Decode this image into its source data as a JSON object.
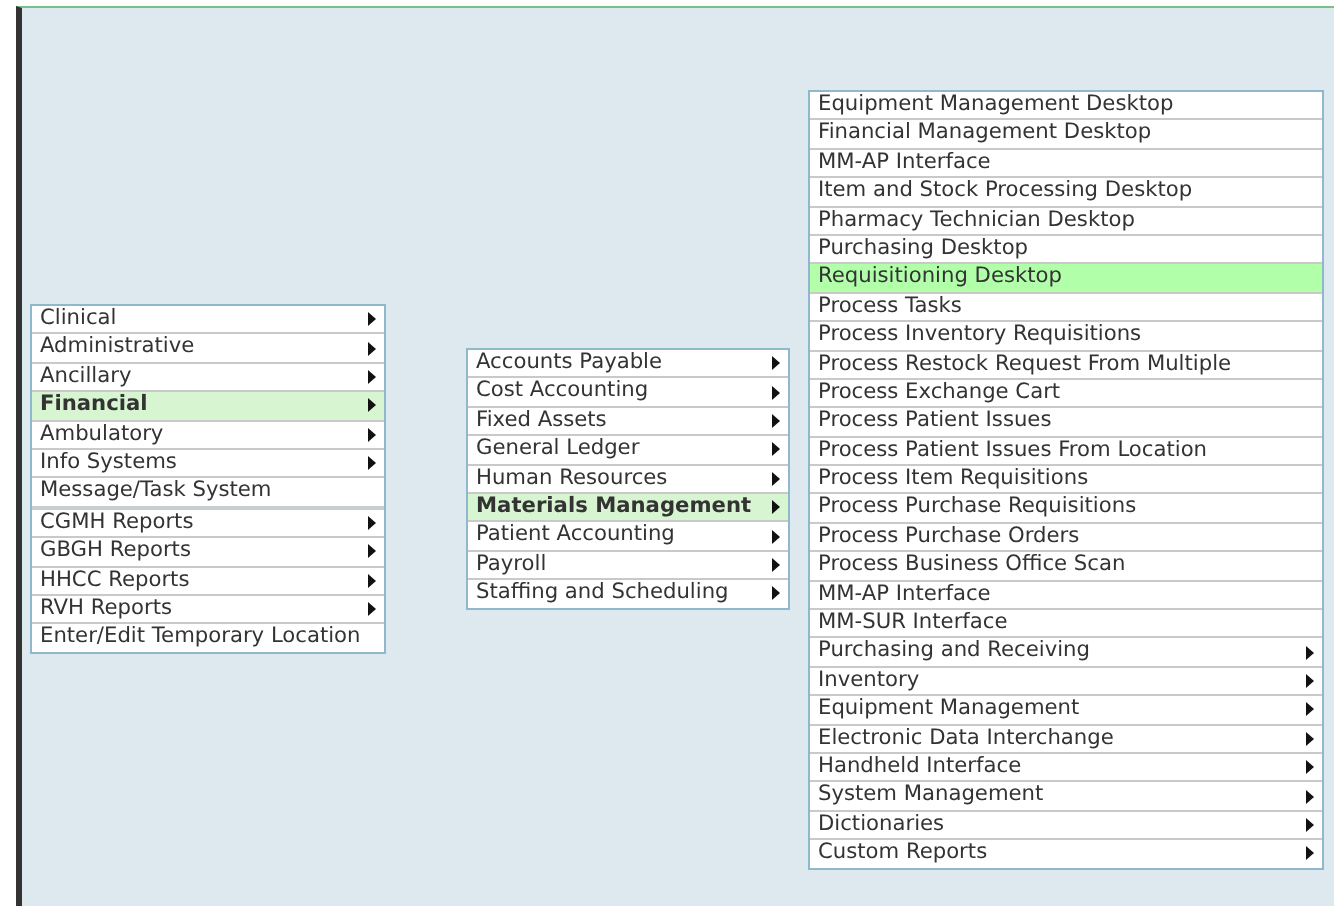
{
  "menus": [
    {
      "items": [
        {
          "label": "Clinical",
          "submenu": true,
          "selected": false,
          "hovered": false
        },
        {
          "label": "Administrative",
          "submenu": true,
          "selected": false,
          "hovered": false
        },
        {
          "label": "Ancillary",
          "submenu": true,
          "selected": false,
          "hovered": false
        },
        {
          "label": "Financial",
          "submenu": true,
          "selected": true,
          "hovered": false
        },
        {
          "label": "Ambulatory",
          "submenu": true,
          "selected": false,
          "hovered": false
        },
        {
          "label": "Info Systems",
          "submenu": true,
          "selected": false,
          "hovered": false
        },
        {
          "label": "Message/Task System",
          "submenu": false,
          "selected": false,
          "hovered": false
        },
        {
          "label": "CGMH Reports",
          "submenu": true,
          "selected": false,
          "hovered": false,
          "group_start": true
        },
        {
          "label": "GBGH Reports",
          "submenu": true,
          "selected": false,
          "hovered": false
        },
        {
          "label": "HHCC Reports",
          "submenu": true,
          "selected": false,
          "hovered": false
        },
        {
          "label": "RVH Reports",
          "submenu": true,
          "selected": false,
          "hovered": false
        },
        {
          "label": "Enter/Edit Temporary Location",
          "submenu": false,
          "selected": false,
          "hovered": false
        }
      ]
    },
    {
      "items": [
        {
          "label": "Accounts Payable",
          "submenu": true,
          "selected": false,
          "hovered": false
        },
        {
          "label": "Cost Accounting",
          "submenu": true,
          "selected": false,
          "hovered": false
        },
        {
          "label": "Fixed Assets",
          "submenu": true,
          "selected": false,
          "hovered": false
        },
        {
          "label": "General Ledger",
          "submenu": true,
          "selected": false,
          "hovered": false
        },
        {
          "label": "Human Resources",
          "submenu": true,
          "selected": false,
          "hovered": false
        },
        {
          "label": "Materials Management",
          "submenu": true,
          "selected": true,
          "hovered": false
        },
        {
          "label": "Patient Accounting",
          "submenu": true,
          "selected": false,
          "hovered": false
        },
        {
          "label": "Payroll",
          "submenu": true,
          "selected": false,
          "hovered": false
        },
        {
          "label": "Staffing and Scheduling",
          "submenu": true,
          "selected": false,
          "hovered": false
        }
      ]
    },
    {
      "items": [
        {
          "label": "Equipment Management Desktop",
          "submenu": false,
          "selected": false,
          "hovered": false
        },
        {
          "label": "Financial Management Desktop",
          "submenu": false,
          "selected": false,
          "hovered": false
        },
        {
          "label": "MM-AP Interface",
          "submenu": false,
          "selected": false,
          "hovered": false
        },
        {
          "label": "Item and Stock Processing Desktop",
          "submenu": false,
          "selected": false,
          "hovered": false
        },
        {
          "label": "Pharmacy Technician Desktop",
          "submenu": false,
          "selected": false,
          "hovered": false
        },
        {
          "label": "Purchasing Desktop",
          "submenu": false,
          "selected": false,
          "hovered": false
        },
        {
          "label": "Requisitioning Desktop",
          "submenu": false,
          "selected": false,
          "hovered": true
        },
        {
          "label": "Process Tasks",
          "submenu": false,
          "selected": false,
          "hovered": false
        },
        {
          "label": "Process Inventory Requisitions",
          "submenu": false,
          "selected": false,
          "hovered": false
        },
        {
          "label": "Process Restock Request From Multiple",
          "submenu": false,
          "selected": false,
          "hovered": false
        },
        {
          "label": "Process Exchange Cart",
          "submenu": false,
          "selected": false,
          "hovered": false
        },
        {
          "label": "Process Patient Issues",
          "submenu": false,
          "selected": false,
          "hovered": false
        },
        {
          "label": "Process Patient Issues From Location",
          "submenu": false,
          "selected": false,
          "hovered": false
        },
        {
          "label": "Process Item Requisitions",
          "submenu": false,
          "selected": false,
          "hovered": false
        },
        {
          "label": "Process Purchase Requisitions",
          "submenu": false,
          "selected": false,
          "hovered": false
        },
        {
          "label": "Process Purchase Orders",
          "submenu": false,
          "selected": false,
          "hovered": false
        },
        {
          "label": "Process Business Office Scan",
          "submenu": false,
          "selected": false,
          "hovered": false
        },
        {
          "label": "MM-AP Interface",
          "submenu": false,
          "selected": false,
          "hovered": false
        },
        {
          "label": "MM-SUR Interface",
          "submenu": false,
          "selected": false,
          "hovered": false
        },
        {
          "label": "Purchasing and Receiving",
          "submenu": true,
          "selected": false,
          "hovered": false
        },
        {
          "label": "Inventory",
          "submenu": true,
          "selected": false,
          "hovered": false
        },
        {
          "label": "Equipment Management",
          "submenu": true,
          "selected": false,
          "hovered": false
        },
        {
          "label": "Electronic Data Interchange",
          "submenu": true,
          "selected": false,
          "hovered": false
        },
        {
          "label": "Handheld Interface",
          "submenu": true,
          "selected": false,
          "hovered": false
        },
        {
          "label": "System Management",
          "submenu": true,
          "selected": false,
          "hovered": false
        },
        {
          "label": "Dictionaries",
          "submenu": true,
          "selected": false,
          "hovered": false
        },
        {
          "label": "Custom Reports",
          "submenu": true,
          "selected": false,
          "hovered": false
        }
      ]
    }
  ]
}
